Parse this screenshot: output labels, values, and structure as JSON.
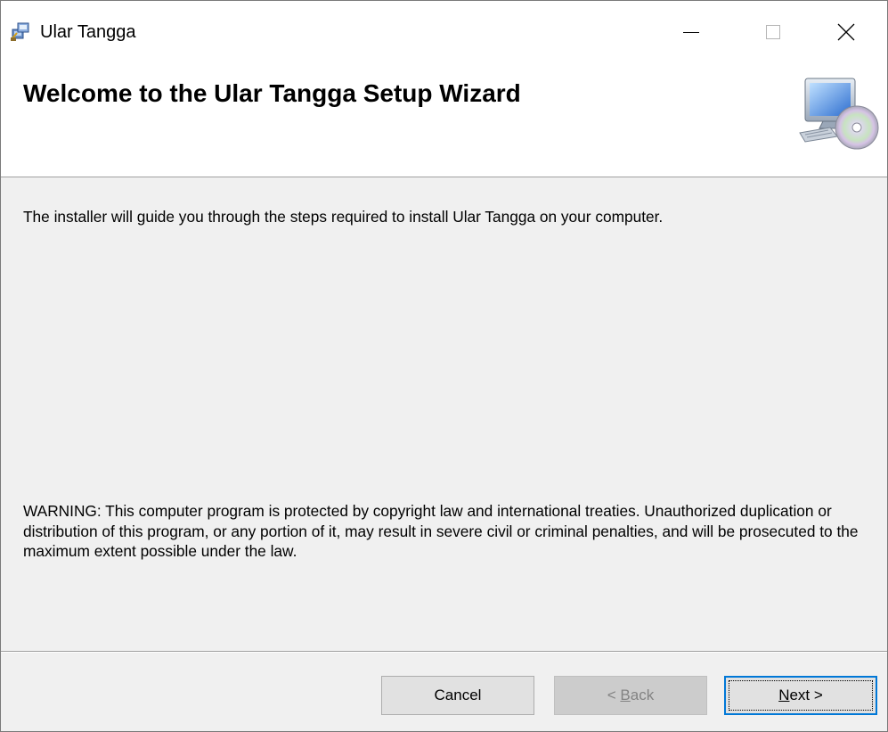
{
  "window": {
    "title": "Ular Tangga"
  },
  "caption_buttons": {
    "minimize_icon": "minimize-icon",
    "maximize_icon": "maximize-icon",
    "close_icon": "close-icon"
  },
  "header": {
    "title": "Welcome to the Ular Tangga Setup Wizard",
    "icon": "computer-cd-icon"
  },
  "body": {
    "intro": "The installer will guide you through the steps required to install Ular Tangga on your computer.",
    "warning": "WARNING: This computer program is protected by copyright law and international treaties. Unauthorized duplication or distribution of this program, or any portion of it, may result in severe civil or criminal penalties, and will be prosecuted to the maximum extent possible under the law."
  },
  "buttons": {
    "cancel": "Cancel",
    "back_prefix": "< ",
    "back_mnemonic": "B",
    "back_rest": "ack",
    "next_mnemonic": "N",
    "next_rest": "ext >"
  },
  "colors": {
    "focus_border": "#0078d7",
    "dialog_background": "#f0f0f0"
  }
}
